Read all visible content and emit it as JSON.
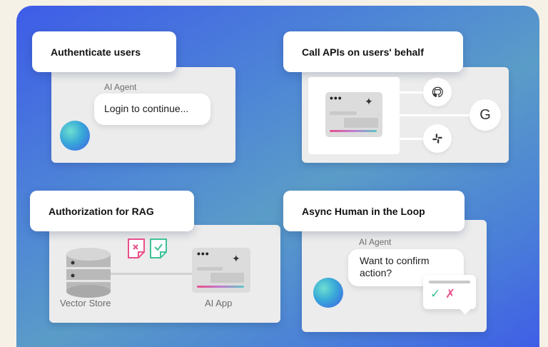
{
  "cards": {
    "authenticate": {
      "title": "Authenticate users",
      "agent_label": "AI Agent",
      "bubble_text": "Login to continue..."
    },
    "call_apis": {
      "title": "Call APIs on users' behalf",
      "google_letter": "G"
    },
    "rag": {
      "title": "Authorization for RAG",
      "vector_label": "Vector Store",
      "app_label": "AI App"
    },
    "async": {
      "title": "Async Human in the Loop",
      "agent_label": "AI Agent",
      "bubble_text": "Want to confirm action?",
      "check": "✓",
      "cross": "✗"
    }
  },
  "icons": [
    "github-icon",
    "google-icon",
    "slack-icon",
    "sparkle-icon",
    "database-icon",
    "document-icon"
  ],
  "colors": {
    "accent_pink": "#e8508a",
    "accent_teal": "#3fc29a",
    "bg_blue": "#4a7fd8"
  }
}
